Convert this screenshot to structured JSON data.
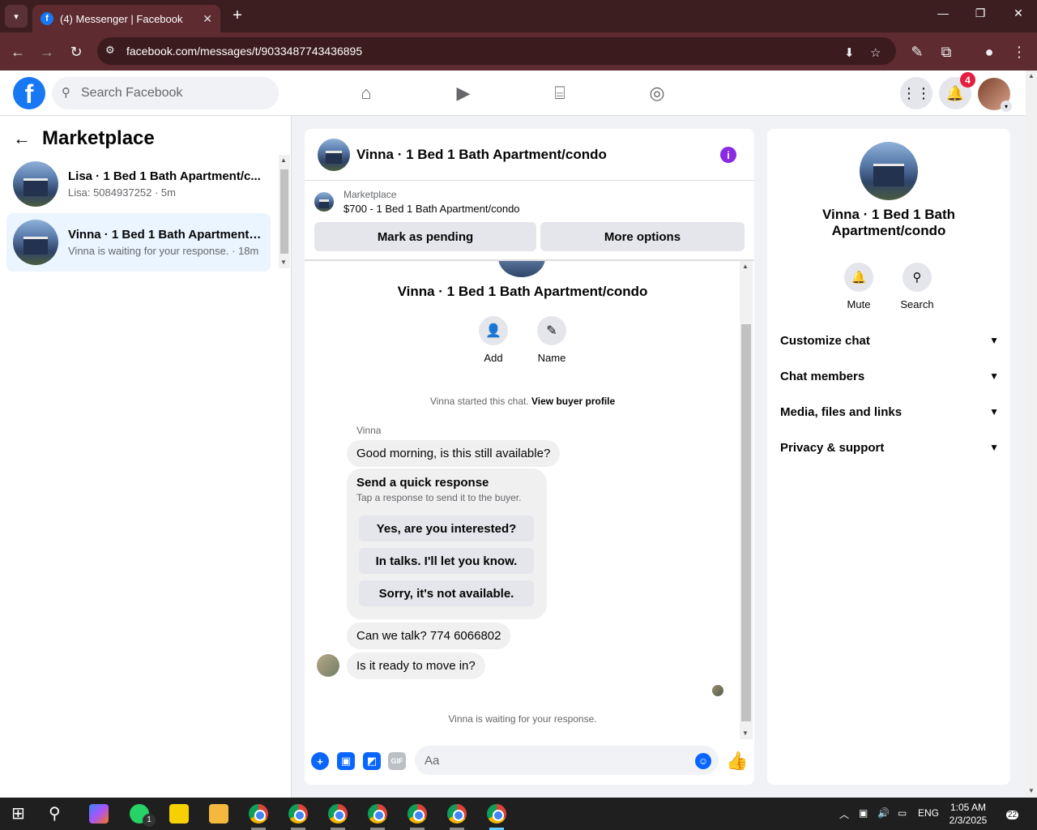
{
  "browser": {
    "tab_title": "(4) Messenger | Facebook",
    "url": "facebook.com/messages/t/9033487743436895"
  },
  "fbnav": {
    "search_placeholder": "Search Facebook",
    "notification_count": "4"
  },
  "sidebar": {
    "title": "Marketplace",
    "conversations": [
      {
        "name": "Lisa · 1 Bed 1 Bath Apartment/c...",
        "preview": "Lisa: 5084937252 · 5m"
      },
      {
        "name": "Vinna · 1 Bed 1 Bath Apartment/...",
        "preview": "Vinna is waiting for your response. · 18m"
      }
    ]
  },
  "chat": {
    "header_title": "Vinna · 1 Bed 1 Bath Apartment/condo",
    "marketplace_label": "Marketplace",
    "listing": "$700 - 1 Bed 1 Bath Apartment/condo",
    "mark_pending": "Mark as pending",
    "more_options": "More options",
    "big_title": "Vinna · 1 Bed 1 Bath Apartment/condo",
    "add_label": "Add",
    "name_label": "Name",
    "started_text": "Vinna started this chat.",
    "view_profile": "View buyer profile",
    "sender": "Vinna",
    "messages": [
      "Good morning, is this still available?",
      "Can we talk? 774 6066802",
      "Is it ready to move in?"
    ],
    "quick_response": {
      "title": "Send a quick response",
      "subtitle": "Tap a response to send it to the buyer.",
      "options": [
        "Yes, are you interested?",
        "In talks. I'll let you know.",
        "Sorry, it's not available."
      ]
    },
    "waiting": "Vinna is waiting for your response.",
    "composer_placeholder": "Aa"
  },
  "details": {
    "name": "Vinna · 1 Bed 1 Bath Apartment/condo",
    "mute": "Mute",
    "search": "Search",
    "sections": [
      "Customize chat",
      "Chat members",
      "Media, files and links",
      "Privacy & support"
    ]
  },
  "taskbar": {
    "whatsapp_badge": "1",
    "lang": "ENG",
    "time": "1:05 AM",
    "date": "2/3/2025",
    "notif_count": "22"
  }
}
